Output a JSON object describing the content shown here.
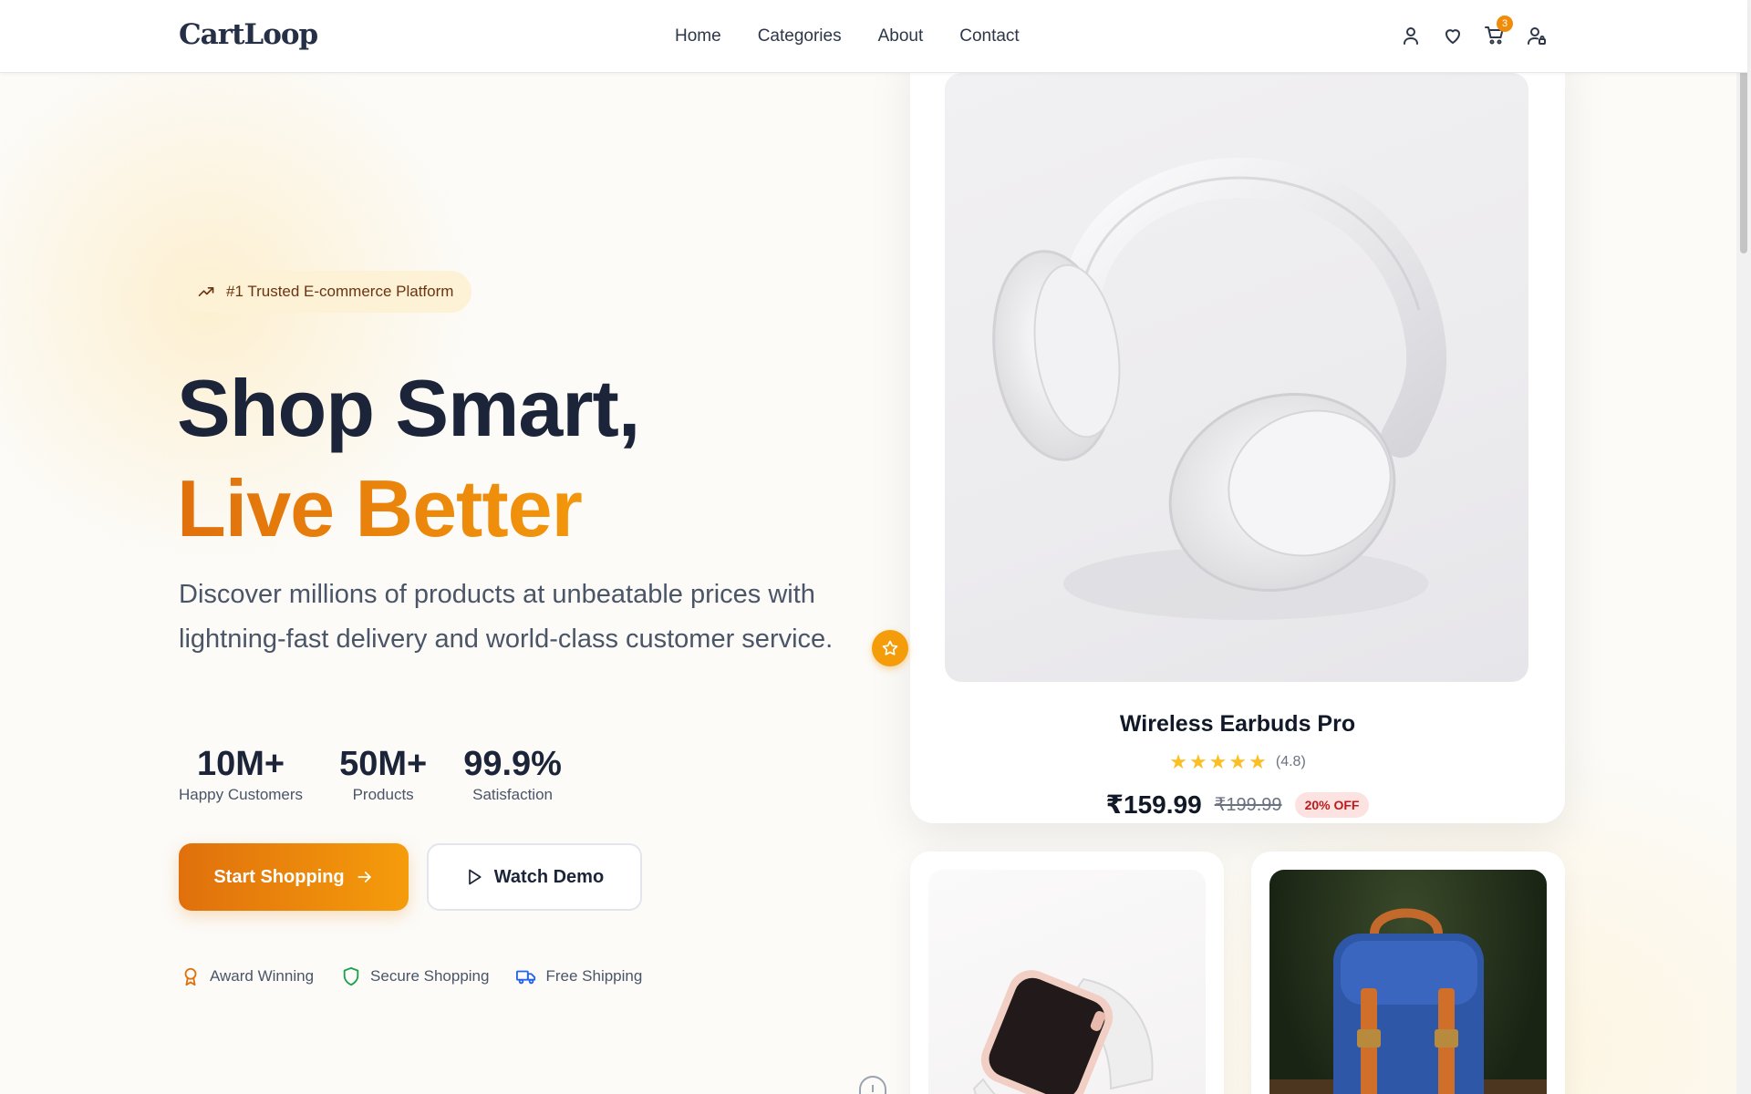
{
  "brand": {
    "name": "CartLoop"
  },
  "nav": {
    "items": [
      {
        "label": "Home"
      },
      {
        "label": "Categories"
      },
      {
        "label": "About"
      },
      {
        "label": "Contact"
      }
    ]
  },
  "header_icons": {
    "account": "user-icon",
    "wishlist": "heart-icon",
    "cart": "cart-icon",
    "cart_count": "3",
    "profile": "user-lock-icon"
  },
  "hero": {
    "badge": "#1 Trusted E-commerce Platform",
    "title_line1": "Shop Smart,",
    "title_line2": "Live Better",
    "description": "Discover millions of products at unbeatable prices with lightning-fast delivery and world-class customer service.",
    "stats": [
      {
        "value": "10M+",
        "label": "Happy Customers"
      },
      {
        "value": "50M+",
        "label": "Products"
      },
      {
        "value": "99.9%",
        "label": "Satisfaction"
      }
    ],
    "primary_cta": "Start Shopping",
    "secondary_cta": "Watch Demo",
    "features": [
      {
        "label": "Award Winning",
        "icon": "award-icon",
        "color": "#e0700c"
      },
      {
        "label": "Secure Shopping",
        "icon": "shield-icon",
        "color": "#16a34a"
      },
      {
        "label": "Free Shipping",
        "icon": "truck-icon",
        "color": "#2563eb"
      }
    ]
  },
  "featured_product": {
    "name": "Wireless Earbuds Pro",
    "rating_text": "(4.8)",
    "rating_value": 4.8,
    "price": "₹159.99",
    "old_price": "₹199.99",
    "discount": "20% OFF",
    "image": "white headphones"
  },
  "secondary_products": [
    {
      "image": "smartwatch"
    },
    {
      "image": "blue backpack"
    }
  ],
  "colors": {
    "accent": "#f08c0c",
    "accent_dark": "#e0700c",
    "heading": "#1b2438",
    "star": "#fbbf24"
  }
}
